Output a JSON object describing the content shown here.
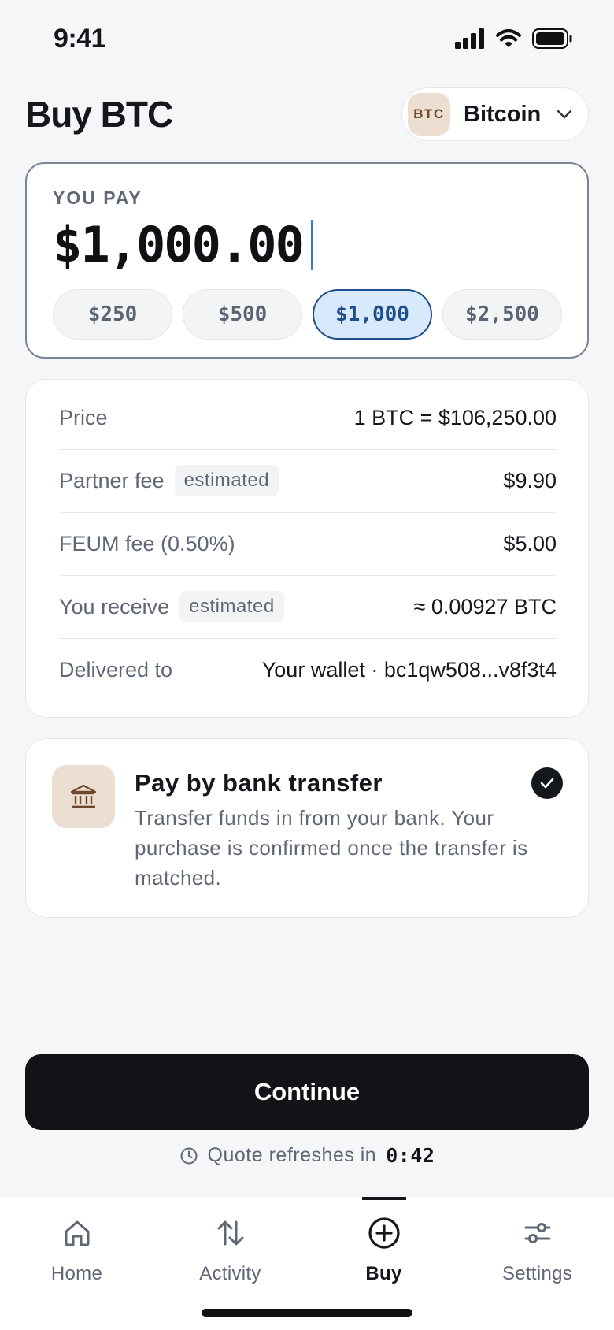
{
  "status_bar": {
    "time": "9:41"
  },
  "header": {
    "title": "Buy BTC"
  },
  "asset_picker": {
    "badge": "BTC",
    "name": "Bitcoin"
  },
  "pay": {
    "label": "YOU PAY",
    "amount": "$1,000.00",
    "chips": [
      {
        "label": "$250",
        "selected": false
      },
      {
        "label": "$500",
        "selected": false
      },
      {
        "label": "$1,000",
        "selected": true
      },
      {
        "label": "$2,500",
        "selected": false
      }
    ]
  },
  "details": {
    "price": {
      "label": "Price",
      "value": "1 BTC = $106,250.00"
    },
    "partner_fee": {
      "label": "Partner fee",
      "tag": "estimated",
      "value": "$9.90"
    },
    "feum_fee": {
      "label": "FEUM fee (0.50%)",
      "value": "$5.00"
    },
    "receive": {
      "label": "You receive",
      "tag": "estimated",
      "value": "≈ 0.00927 BTC"
    },
    "delivered": {
      "label": "Delivered to",
      "value": "Your wallet · bc1qw508...v8f3t4"
    }
  },
  "payment_method": {
    "title": "Pay by bank transfer",
    "description": "Transfer funds in from your bank. Your purchase is confirmed once the transfer is matched.",
    "selected": true
  },
  "continue_label": "Continue",
  "quote": {
    "text": "Quote refreshes in",
    "timer": "0:42"
  },
  "tabs": [
    {
      "label": "Home",
      "icon": "home-icon",
      "active": false
    },
    {
      "label": "Activity",
      "icon": "arrows-up-down-icon",
      "active": false
    },
    {
      "label": "Buy",
      "icon": "plus-circle-icon",
      "active": true
    },
    {
      "label": "Settings",
      "icon": "sliders-icon",
      "active": false
    }
  ],
  "colors": {
    "accent": "#1f4e8c",
    "accent_bg": "#d7e9fb",
    "primary_button": "#111317",
    "asset_badge_bg": "#ecdfd2",
    "caret": "#3a78d8"
  }
}
